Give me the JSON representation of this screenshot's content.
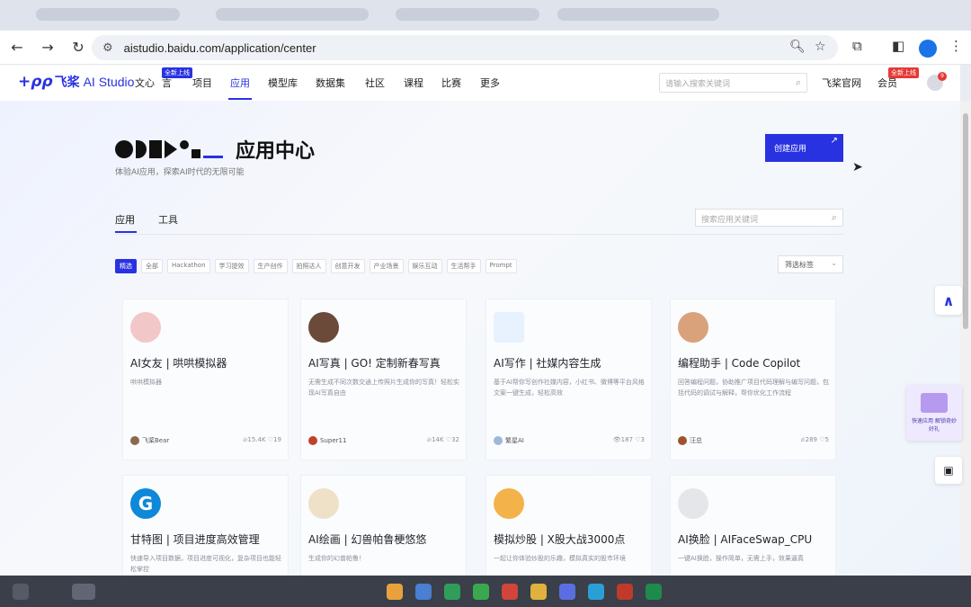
{
  "browser": {
    "url": "aistudio.baidu.com/application/center",
    "nav": {
      "back": "←",
      "forward": "→",
      "reload": "↻"
    }
  },
  "site_header": {
    "logo_mark": "+ρρ",
    "logo_cn": "飞桨",
    "logo_en": "AI Studio",
    "nav": [
      "文心一言",
      "项目",
      "应用",
      "模型库",
      "数据集",
      "社区",
      "课程",
      "比赛",
      "更多"
    ],
    "nav_visible": [
      "文心",
      "言",
      "项目",
      "应用",
      "模型库",
      "数据集",
      "社区",
      "课程",
      "比赛",
      "更多"
    ],
    "new_badge": "全新上线",
    "search_placeholder": "请输入搜索关键词",
    "official_site": "飞桨官网",
    "member": "会员",
    "member_badge": "全新上线",
    "notif_count": "9"
  },
  "hero": {
    "title": "应用中心",
    "subtitle": "体验AI应用，探索AI时代的无限可能",
    "create_button": "创建应用",
    "create_arrow": "↗"
  },
  "tabs": {
    "app": "应用",
    "tool": "工具"
  },
  "app_search_placeholder": "搜索应用关键词",
  "chips": [
    "精选",
    "全部",
    "Hackathon",
    "学习提效",
    "生产创作",
    "拍照达人",
    "创意开发",
    "产业场景",
    "娱乐互动",
    "生活帮手",
    "Prompt"
  ],
  "filter": {
    "label": "筛选标签",
    "caret": "⌄"
  },
  "cards": [
    {
      "title": "AI女友 | 哄哄模拟器",
      "desc": "哄哄模拟器",
      "author": "飞桨Bear",
      "views": "15.4K",
      "likes": "19",
      "color": "#f2c7c7"
    },
    {
      "title": "AI写真 | GO! 定制新春写真",
      "desc": "无需生成不同次数交通上传照片生成你的写真！轻松实现AI写真自由",
      "author": "Super11",
      "views": "14K",
      "likes": "32",
      "color": "#6b4a3a"
    },
    {
      "title": "AI写作 | 社媒内容生成",
      "desc": "基于AI帮你写创作社媒内容，小红书、微博等平台风格文案一键生成，轻松高效",
      "author": "繁星AI",
      "views": "187",
      "likes": "3",
      "color": "#e8f2ff"
    },
    {
      "title": "编程助手 | Code Copilot",
      "desc": "回答编程问题，协助推广项目代码理解与编写问题，包括代码的调试与解释，帮你优化工作流程",
      "author": "汪总",
      "views": "289",
      "likes": "5",
      "color": "#d9a27a"
    },
    {
      "title": "甘特图 | 项目进度高效管理",
      "desc": "快速导入项目数据，项目进度可视化，复杂项目也能轻松掌控",
      "author": "",
      "views": "",
      "likes": "",
      "color": "#0e88d8"
    },
    {
      "title": "AI绘画 | 幻兽帕鲁梗悠悠",
      "desc": "生成你的幻兽帕鲁！",
      "author": "",
      "views": "",
      "likes": "",
      "color": "#efe0c8"
    },
    {
      "title": "模拟炒股 | X股大战3000点",
      "desc": "一起让你体验炒股的乐趣，模拟真实的股市环境",
      "author": "",
      "views": "",
      "likes": "",
      "color": "#f3b34a"
    },
    {
      "title": "AI换脸 | AIFaceSwap_CPU",
      "desc": "一键AI换脸，操作简单，无需上手，效果逼真",
      "author": "",
      "views": "",
      "likes": "",
      "color": "#e5e6ea"
    }
  ],
  "side_promo": "快速应用 解锁奇妙好礼",
  "colors": {
    "accent": "#2932e1",
    "badge_red": "#e53935",
    "page_bg": "#f5f7fb"
  }
}
